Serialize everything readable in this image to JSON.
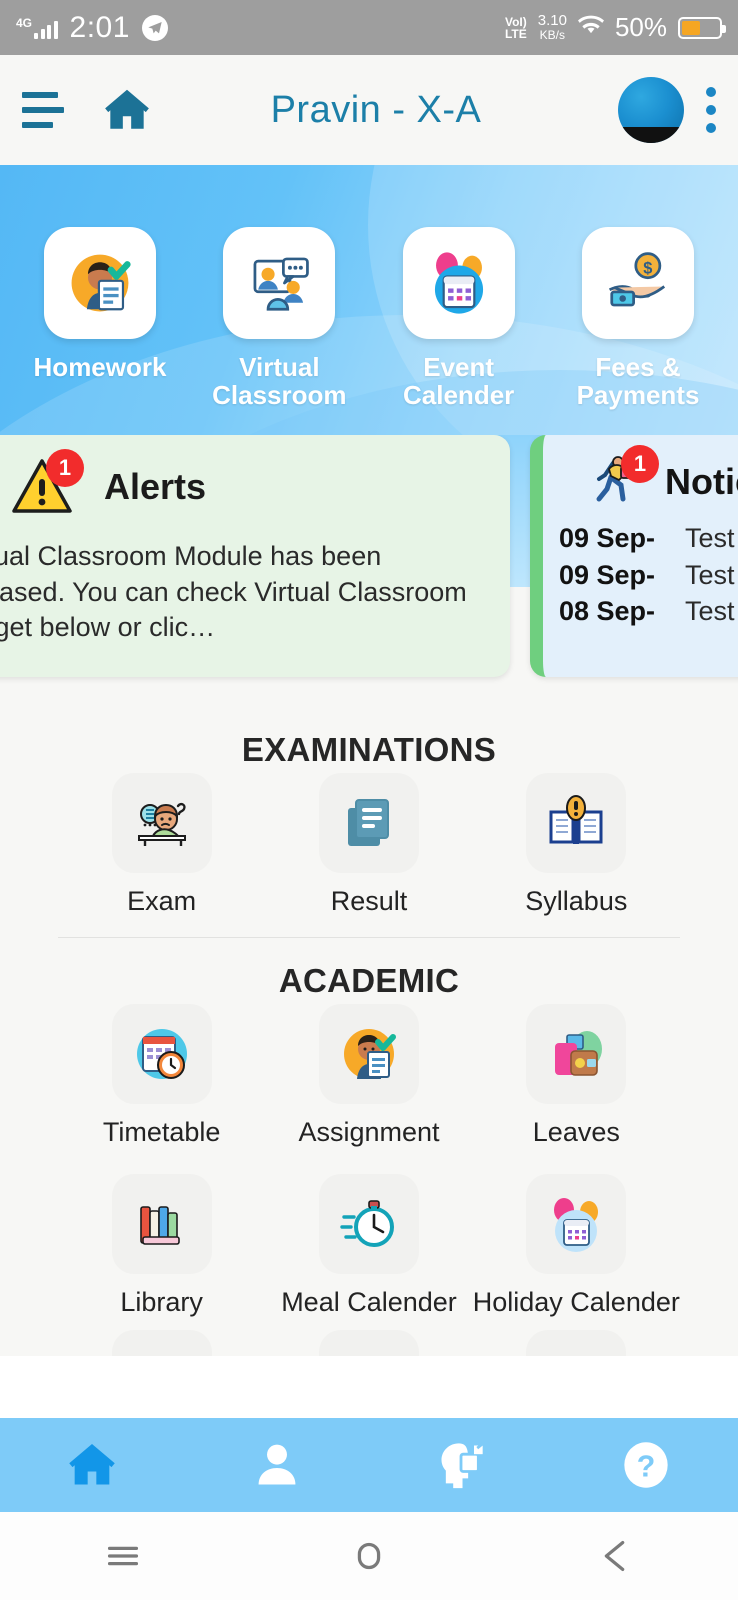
{
  "status_bar": {
    "network_generation": "4G",
    "time": "2:01",
    "volte": "VoLTE",
    "volte_top": "VoI)",
    "data_rate": "3.10",
    "data_rate_unit": "KB/s",
    "battery_percent": "50%"
  },
  "app_bar": {
    "title": "Pravin - X-A",
    "menu_icon": "hamburger-icon",
    "home_icon": "home-icon",
    "avatar_icon": "user-avatar",
    "overflow_icon": "kebab-menu-icon"
  },
  "quick_actions": [
    {
      "label": "Homework",
      "icon": "homework-icon"
    },
    {
      "label": "Virtual Classroom",
      "icon": "virtual-classroom-icon"
    },
    {
      "label": "Event Calender",
      "icon": "event-calendar-icon"
    },
    {
      "label": "Fees & Payments",
      "icon": "fees-payments-icon"
    }
  ],
  "alerts_card": {
    "title": "Alerts",
    "badge": "1",
    "icon": "warning-triangle-icon",
    "message": "Virtual Classroom Module has been released. You can check Virtual Classroom widget below or clic…"
  },
  "notice_card": {
    "title": "Notice",
    "badge": "1",
    "icon": "running-delivery-icon",
    "rows": [
      {
        "date": "09 Sep-",
        "text": "Test"
      },
      {
        "date": "09 Sep-",
        "text": "Test sach"
      },
      {
        "date": "08 Sep-",
        "text": "Test tesi"
      }
    ]
  },
  "sections": [
    {
      "title": "EXAMINATIONS",
      "items": [
        {
          "label": "Exam",
          "icon": "exam-student-icon"
        },
        {
          "label": "Result",
          "icon": "result-document-icon"
        },
        {
          "label": "Syllabus",
          "icon": "syllabus-book-icon"
        }
      ]
    },
    {
      "title": "ACADEMIC",
      "items": [
        {
          "label": "Timetable",
          "icon": "timetable-clock-icon"
        },
        {
          "label": "Assignment",
          "icon": "assignment-icon"
        },
        {
          "label": "Leaves",
          "icon": "leaves-bag-icon"
        },
        {
          "label": "Library",
          "icon": "library-books-icon"
        },
        {
          "label": "Meal Calender",
          "icon": "meal-stopwatch-icon"
        },
        {
          "label": "Holiday Calender",
          "icon": "holiday-calendar-icon"
        }
      ]
    }
  ],
  "bottom_nav": [
    {
      "name": "home",
      "icon": "home-icon",
      "active": true
    },
    {
      "name": "profile",
      "icon": "person-icon",
      "active": false
    },
    {
      "name": "learning",
      "icon": "head-puzzle-icon",
      "active": false
    },
    {
      "name": "help",
      "icon": "question-mark-icon",
      "active": false
    }
  ],
  "system_nav": [
    {
      "name": "recents",
      "icon": "recents-icon"
    },
    {
      "name": "home",
      "icon": "circle-home-icon"
    },
    {
      "name": "back",
      "icon": "back-arrow-icon"
    }
  ],
  "colors": {
    "hero_blue": "#63c2f8",
    "header_teal": "#1c7fa8",
    "alerts_bg": "#e7f4e6",
    "notice_bg": "#e3f0fb",
    "notice_accent": "#6fcf7f",
    "badge_red": "#f22c2c",
    "bottom_nav": "#7ecbf8",
    "battery_amber": "#F5A623"
  }
}
